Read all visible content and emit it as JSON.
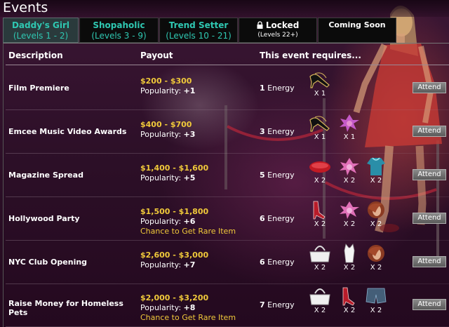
{
  "title": "Events",
  "tabs": [
    {
      "name": "Daddy's Girl",
      "levels": "(Levels 1 - 2)"
    },
    {
      "name": "Shopaholic",
      "levels": "(Levels 3 - 9)"
    },
    {
      "name": "Trend Setter",
      "levels": "(Levels 10 - 21)"
    },
    {
      "name": "Locked",
      "levels": "(Levels 22+)"
    },
    {
      "name": "Coming Soon",
      "levels": ""
    }
  ],
  "headers": {
    "description": "Description",
    "payout": "Payout",
    "requires": "This event requires..."
  },
  "popularity_label": "Popularity:",
  "energy_label": "Energy",
  "attend_label": "Attend",
  "rows": [
    {
      "name": "Film Premiere",
      "money": "$200 - $300",
      "popularity": "+1",
      "rare": "",
      "energy": "1",
      "items": [
        {
          "icon": "black-heels-icon",
          "qty": "X 1"
        }
      ]
    },
    {
      "name": "Emcee Music Video Awards",
      "money": "$400 - $700",
      "popularity": "+3",
      "rare": "",
      "energy": "3",
      "items": [
        {
          "icon": "black-heels-icon",
          "qty": "X 1"
        },
        {
          "icon": "purple-hair-icon",
          "qty": "X 1"
        }
      ]
    },
    {
      "name": "Magazine Spread",
      "money": "$1,400 - $1,600",
      "popularity": "+5",
      "rare": "",
      "energy": "5",
      "items": [
        {
          "icon": "red-clutch-icon",
          "qty": "X 2"
        },
        {
          "icon": "pink-hair-icon",
          "qty": "X 2"
        },
        {
          "icon": "teal-top-icon",
          "qty": "X 2"
        }
      ]
    },
    {
      "name": "Hollywood Party",
      "money": "$1,500 - $1,800",
      "popularity": "+6",
      "rare": "Chance to Get Rare Item",
      "energy": "6",
      "items": [
        {
          "icon": "red-heels-icon",
          "qty": "X 2"
        },
        {
          "icon": "pink-hair-icon",
          "qty": "X 2"
        },
        {
          "icon": "auburn-hair-icon",
          "qty": "X 2"
        }
      ]
    },
    {
      "name": "NYC Club Opening",
      "money": "$2,600 - $3,000",
      "popularity": "+7",
      "rare": "",
      "energy": "6",
      "items": [
        {
          "icon": "white-bag-icon",
          "qty": "X 2"
        },
        {
          "icon": "white-top-icon",
          "qty": "X 2"
        },
        {
          "icon": "auburn-hair-icon",
          "qty": "X 2"
        }
      ]
    },
    {
      "name": "Raise Money for Homeless Pets",
      "money": "$2,000 - $3,200",
      "popularity": "+8",
      "rare": "Chance to Get Rare Item",
      "energy": "7",
      "items": [
        {
          "icon": "white-bag-icon",
          "qty": "X 2"
        },
        {
          "icon": "red-heels-icon",
          "qty": "X 2"
        },
        {
          "icon": "denim-shorts-icon",
          "qty": "X 2"
        }
      ]
    }
  ],
  "colors": {
    "money": "#f0c93a",
    "tab_text": "#2fc8b2",
    "active_tab": "#2a3a3c"
  }
}
